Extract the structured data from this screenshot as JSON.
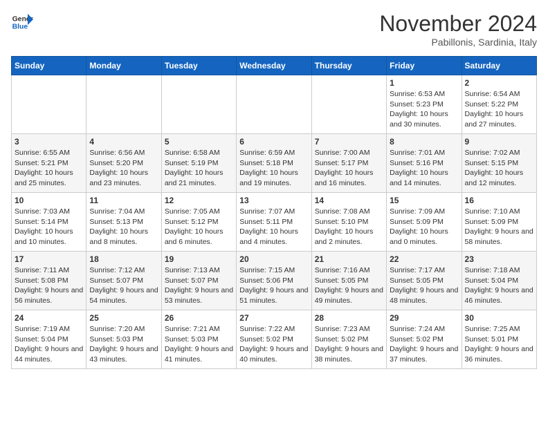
{
  "header": {
    "logo_general": "General",
    "logo_blue": "Blue",
    "month_year": "November 2024",
    "location": "Pabillonis, Sardinia, Italy"
  },
  "calendar": {
    "days_of_week": [
      "Sunday",
      "Monday",
      "Tuesday",
      "Wednesday",
      "Thursday",
      "Friday",
      "Saturday"
    ],
    "weeks": [
      [
        {
          "day": "",
          "info": ""
        },
        {
          "day": "",
          "info": ""
        },
        {
          "day": "",
          "info": ""
        },
        {
          "day": "",
          "info": ""
        },
        {
          "day": "",
          "info": ""
        },
        {
          "day": "1",
          "info": "Sunrise: 6:53 AM\nSunset: 5:23 PM\nDaylight: 10 hours and 30 minutes."
        },
        {
          "day": "2",
          "info": "Sunrise: 6:54 AM\nSunset: 5:22 PM\nDaylight: 10 hours and 27 minutes."
        }
      ],
      [
        {
          "day": "3",
          "info": "Sunrise: 6:55 AM\nSunset: 5:21 PM\nDaylight: 10 hours and 25 minutes."
        },
        {
          "day": "4",
          "info": "Sunrise: 6:56 AM\nSunset: 5:20 PM\nDaylight: 10 hours and 23 minutes."
        },
        {
          "day": "5",
          "info": "Sunrise: 6:58 AM\nSunset: 5:19 PM\nDaylight: 10 hours and 21 minutes."
        },
        {
          "day": "6",
          "info": "Sunrise: 6:59 AM\nSunset: 5:18 PM\nDaylight: 10 hours and 19 minutes."
        },
        {
          "day": "7",
          "info": "Sunrise: 7:00 AM\nSunset: 5:17 PM\nDaylight: 10 hours and 16 minutes."
        },
        {
          "day": "8",
          "info": "Sunrise: 7:01 AM\nSunset: 5:16 PM\nDaylight: 10 hours and 14 minutes."
        },
        {
          "day": "9",
          "info": "Sunrise: 7:02 AM\nSunset: 5:15 PM\nDaylight: 10 hours and 12 minutes."
        }
      ],
      [
        {
          "day": "10",
          "info": "Sunrise: 7:03 AM\nSunset: 5:14 PM\nDaylight: 10 hours and 10 minutes."
        },
        {
          "day": "11",
          "info": "Sunrise: 7:04 AM\nSunset: 5:13 PM\nDaylight: 10 hours and 8 minutes."
        },
        {
          "day": "12",
          "info": "Sunrise: 7:05 AM\nSunset: 5:12 PM\nDaylight: 10 hours and 6 minutes."
        },
        {
          "day": "13",
          "info": "Sunrise: 7:07 AM\nSunset: 5:11 PM\nDaylight: 10 hours and 4 minutes."
        },
        {
          "day": "14",
          "info": "Sunrise: 7:08 AM\nSunset: 5:10 PM\nDaylight: 10 hours and 2 minutes."
        },
        {
          "day": "15",
          "info": "Sunrise: 7:09 AM\nSunset: 5:09 PM\nDaylight: 10 hours and 0 minutes."
        },
        {
          "day": "16",
          "info": "Sunrise: 7:10 AM\nSunset: 5:09 PM\nDaylight: 9 hours and 58 minutes."
        }
      ],
      [
        {
          "day": "17",
          "info": "Sunrise: 7:11 AM\nSunset: 5:08 PM\nDaylight: 9 hours and 56 minutes."
        },
        {
          "day": "18",
          "info": "Sunrise: 7:12 AM\nSunset: 5:07 PM\nDaylight: 9 hours and 54 minutes."
        },
        {
          "day": "19",
          "info": "Sunrise: 7:13 AM\nSunset: 5:07 PM\nDaylight: 9 hours and 53 minutes."
        },
        {
          "day": "20",
          "info": "Sunrise: 7:15 AM\nSunset: 5:06 PM\nDaylight: 9 hours and 51 minutes."
        },
        {
          "day": "21",
          "info": "Sunrise: 7:16 AM\nSunset: 5:05 PM\nDaylight: 9 hours and 49 minutes."
        },
        {
          "day": "22",
          "info": "Sunrise: 7:17 AM\nSunset: 5:05 PM\nDaylight: 9 hours and 48 minutes."
        },
        {
          "day": "23",
          "info": "Sunrise: 7:18 AM\nSunset: 5:04 PM\nDaylight: 9 hours and 46 minutes."
        }
      ],
      [
        {
          "day": "24",
          "info": "Sunrise: 7:19 AM\nSunset: 5:04 PM\nDaylight: 9 hours and 44 minutes."
        },
        {
          "day": "25",
          "info": "Sunrise: 7:20 AM\nSunset: 5:03 PM\nDaylight: 9 hours and 43 minutes."
        },
        {
          "day": "26",
          "info": "Sunrise: 7:21 AM\nSunset: 5:03 PM\nDaylight: 9 hours and 41 minutes."
        },
        {
          "day": "27",
          "info": "Sunrise: 7:22 AM\nSunset: 5:02 PM\nDaylight: 9 hours and 40 minutes."
        },
        {
          "day": "28",
          "info": "Sunrise: 7:23 AM\nSunset: 5:02 PM\nDaylight: 9 hours and 38 minutes."
        },
        {
          "day": "29",
          "info": "Sunrise: 7:24 AM\nSunset: 5:02 PM\nDaylight: 9 hours and 37 minutes."
        },
        {
          "day": "30",
          "info": "Sunrise: 7:25 AM\nSunset: 5:01 PM\nDaylight: 9 hours and 36 minutes."
        }
      ]
    ]
  }
}
